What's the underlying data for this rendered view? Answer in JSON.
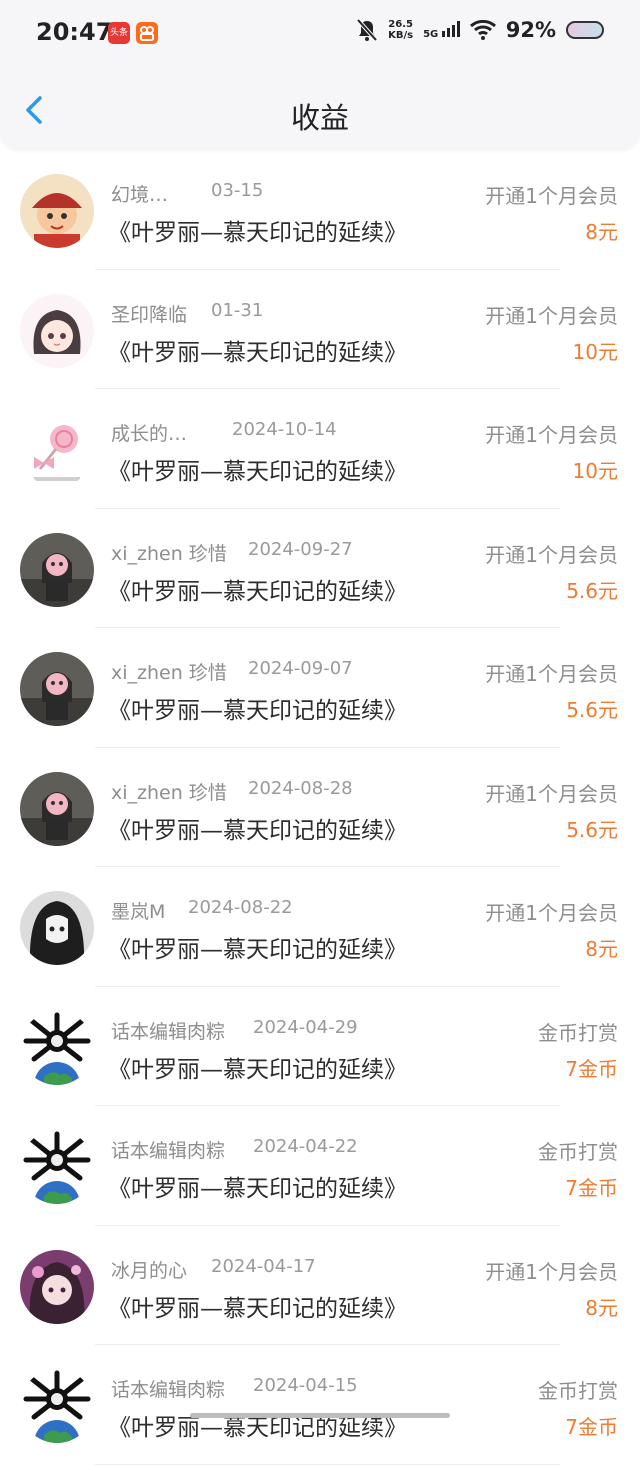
{
  "status_bar": {
    "time": "20:47",
    "badge_toutiao": "头条",
    "badge_kuaishou": "",
    "net_speed_value": "26.5",
    "net_speed_unit": "KB/s",
    "signal": "5G",
    "battery": "92%"
  },
  "header": {
    "title": "收益"
  },
  "colors": {
    "amount": "#ee7b30",
    "muted": "#8e8e8e"
  },
  "earnings": [
    {
      "user": "幻境…",
      "date": "03-15",
      "book": "《叶罗丽—慕天印记的延续》",
      "type": "开通1个月会员",
      "amount": "8元",
      "avatar_icon": "festive-kid-avatar"
    },
    {
      "user": "圣印降临",
      "date": "01-31",
      "book": "《叶罗丽—慕天印记的延续》",
      "type": "开通1个月会员",
      "amount": "10元",
      "avatar_icon": "chibi-girl-avatar"
    },
    {
      "user": "成长的…",
      "date": "2024-10-14",
      "book": "《叶罗丽—慕天印记的延续》",
      "type": "开通1个月会员",
      "amount": "10元",
      "avatar_icon": "lollipop-avatar"
    },
    {
      "user": "xi_zhen 珍惜",
      "date": "2024-09-27",
      "book": "《叶罗丽—慕天印记的延续》",
      "type": "开通1个月会员",
      "amount": "5.6元",
      "avatar_icon": "photo-avatar"
    },
    {
      "user": "xi_zhen 珍惜",
      "date": "2024-09-07",
      "book": "《叶罗丽—慕天印记的延续》",
      "type": "开通1个月会员",
      "amount": "5.6元",
      "avatar_icon": "photo-avatar"
    },
    {
      "user": "xi_zhen 珍惜",
      "date": "2024-08-28",
      "book": "《叶罗丽—慕天印记的延续》",
      "type": "开通1个月会员",
      "amount": "5.6元",
      "avatar_icon": "photo-avatar"
    },
    {
      "user": "墨岚M",
      "date": "2024-08-22",
      "book": "《叶罗丽—慕天印记的延续》",
      "type": "开通1个月会员",
      "amount": "8元",
      "avatar_icon": "anime-girl-avatar"
    },
    {
      "user": "话本编辑肉粽",
      "date": "2024-04-29",
      "book": "《叶罗丽—慕天印记的延续》",
      "type": "金币打赏",
      "amount": "7金币",
      "avatar_icon": "earth-mascot-avatar"
    },
    {
      "user": "话本编辑肉粽",
      "date": "2024-04-22",
      "book": "《叶罗丽—慕天印记的延续》",
      "type": "金币打赏",
      "amount": "7金币",
      "avatar_icon": "earth-mascot-avatar"
    },
    {
      "user": "冰月的心",
      "date": "2024-04-17",
      "book": "《叶罗丽—慕天印记的延续》",
      "type": "开通1个月会员",
      "amount": "8元",
      "avatar_icon": "anime-princess-avatar"
    },
    {
      "user": "话本编辑肉粽",
      "date": "2024-04-15",
      "book": "《叶罗丽—慕天印记的延续》",
      "type": "金币打赏",
      "amount": "7金币",
      "avatar_icon": "earth-mascot-avatar"
    }
  ]
}
